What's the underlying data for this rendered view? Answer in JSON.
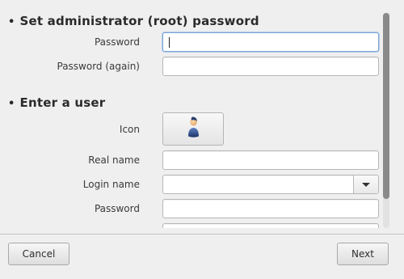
{
  "admin": {
    "title": "Set administrator (root) password",
    "password_label": "Password",
    "password_again_label": "Password (again)",
    "password_value": "",
    "password_again_value": ""
  },
  "user": {
    "title": "Enter a user",
    "icon_label": "Icon",
    "icon_name": "user-avatar-icon",
    "real_name_label": "Real name",
    "real_name_value": "",
    "login_name_label": "Login name",
    "login_name_value": "",
    "password_label": "Password",
    "password_value": ""
  },
  "buttons": {
    "cancel": "Cancel",
    "next": "Next"
  },
  "bullet": "•"
}
